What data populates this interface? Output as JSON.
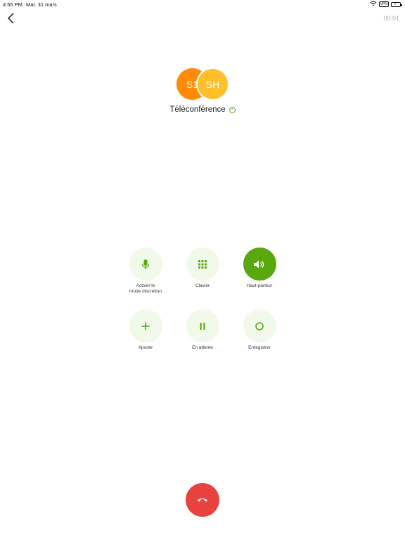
{
  "status_bar": {
    "time": "4:55 PM",
    "date": "Mar. 31 mars",
    "vpn": "VPN"
  },
  "call": {
    "timer": "00:01",
    "title": "Téléconférence",
    "info_icon": "i"
  },
  "participants": [
    {
      "initials": "S1",
      "color": "#ff8a05"
    },
    {
      "initials": "SH",
      "color": "#ffbf2b"
    }
  ],
  "actions": {
    "mute": {
      "label": "Activer le\nmode discrétion",
      "icon": "microphone-icon"
    },
    "keypad": {
      "label": "Clavier",
      "icon": "keypad-icon"
    },
    "speaker": {
      "label": "Haut-parleur",
      "icon": "speaker-icon",
      "active": true
    },
    "add": {
      "label": "Ajouter",
      "icon": "plus-icon"
    },
    "hold": {
      "label": "En attente",
      "icon": "pause-icon"
    },
    "record": {
      "label": "Enregistrer",
      "icon": "record-icon"
    }
  },
  "colors": {
    "accent": "#59a80f",
    "button_bg": "#f1f9ea",
    "hangup": "#e8423f"
  }
}
